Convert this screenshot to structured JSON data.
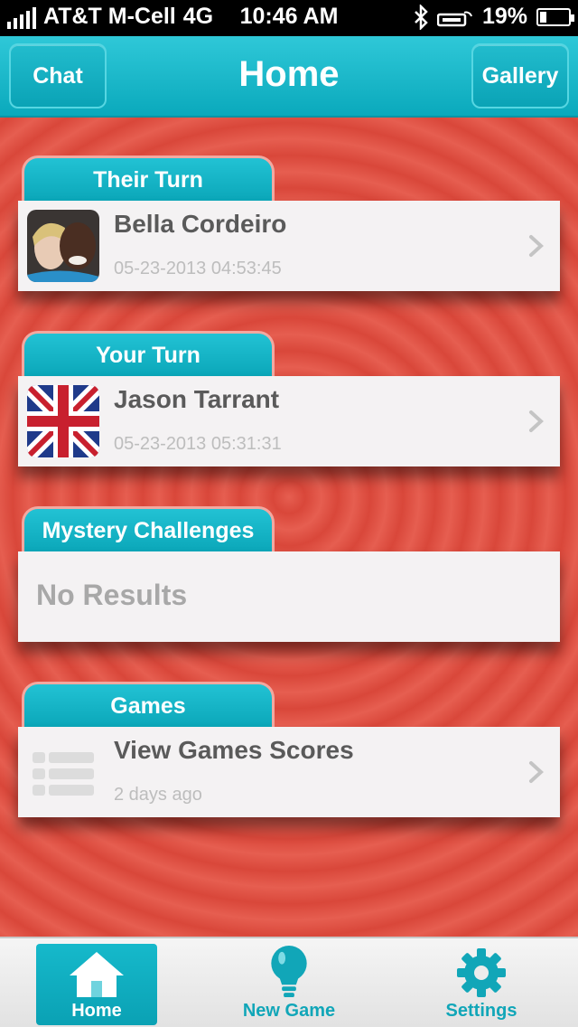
{
  "status_bar": {
    "carrier": "AT&T M-Cell",
    "network": "4G",
    "time": "10:46 AM",
    "battery": "19%"
  },
  "nav": {
    "left_button": "Chat",
    "title": "Home",
    "right_button": "Gallery"
  },
  "sections": {
    "their_turn": {
      "header": "Their Turn",
      "name": "Bella Cordeiro",
      "timestamp": "05-23-2013 04:53:45"
    },
    "your_turn": {
      "header": "Your Turn",
      "name": "Jason Tarrant",
      "timestamp": "05-23-2013 05:31:31"
    },
    "mystery": {
      "header": "Mystery Challenges",
      "empty_text": "No Results"
    },
    "games": {
      "header": "Games",
      "name": "View Games Scores",
      "subtitle": "2 days ago"
    }
  },
  "tab_bar": {
    "home": "Home",
    "new_game": "New Game",
    "settings": "Settings"
  },
  "colors": {
    "accent": "#0aa9bc",
    "background_red": "#e65e50"
  }
}
